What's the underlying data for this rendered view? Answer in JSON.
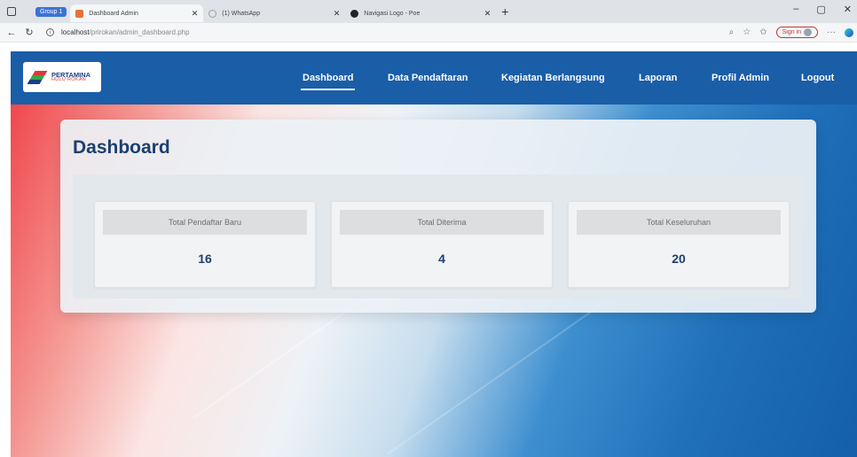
{
  "browser": {
    "tab_group_label": "Group 1",
    "tabs": [
      {
        "title": "Dashboard Admin",
        "active": true,
        "favicon_color": "#e8703a"
      },
      {
        "title": "(1) WhatsApp",
        "active": false,
        "favicon_color": "#9aa0a6"
      },
      {
        "title": "Navigasi Logo - Poe",
        "active": false,
        "favicon_color": "#222222"
      }
    ],
    "new_tab_symbol": "+",
    "window_controls": [
      "–",
      "▢",
      "✕"
    ],
    "url_host": "localhost",
    "url_path": "/prirokan/admin_dashboard.php",
    "signin_label": "Sign in"
  },
  "site": {
    "logo": {
      "line1": "PERTAMINA",
      "line2": "HULU ROKAN"
    },
    "nav": [
      {
        "label": "Dashboard",
        "active": true
      },
      {
        "label": "Data Pendaftaran",
        "active": false
      },
      {
        "label": "Kegiatan Berlangsung",
        "active": false
      },
      {
        "label": "Laporan",
        "active": false
      },
      {
        "label": "Profil Admin",
        "active": false
      },
      {
        "label": "Logout",
        "active": false
      }
    ]
  },
  "dashboard": {
    "title": "Dashboard",
    "stats": [
      {
        "label": "Total Pendaftar Baru",
        "value": "16"
      },
      {
        "label": "Total Diterima",
        "value": "4"
      },
      {
        "label": "Total Keseluruhan",
        "value": "20"
      }
    ]
  },
  "colors": {
    "navbar": "#1a5ea8",
    "accent_text": "#1d3f6e",
    "logo_red": "#d93a3a",
    "logo_green": "#3aa34a",
    "logo_blue": "#1a3f80"
  }
}
